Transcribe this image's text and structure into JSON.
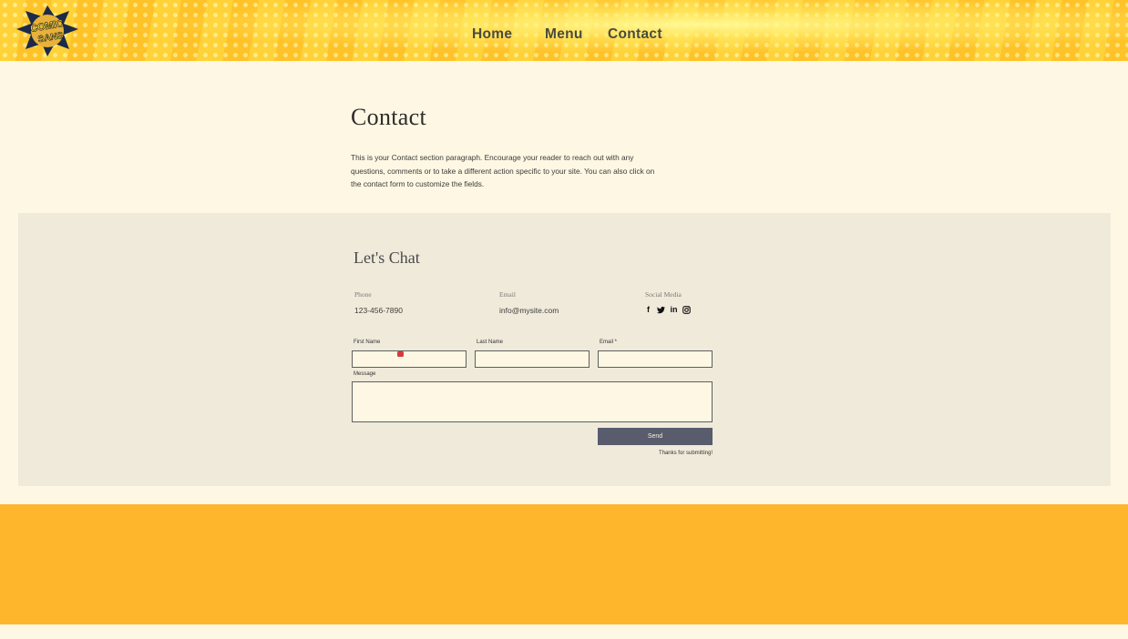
{
  "header": {
    "logo_text_top": "COMIC",
    "logo_text_bottom": "SANS",
    "nav": {
      "home": "Home",
      "menu": "Menu",
      "contact": "Contact"
    }
  },
  "contact": {
    "title": "Contact",
    "paragraph": "This is your Contact section paragraph. Encourage your reader to reach out with any questions, comments or to take a different action specific to your site. You can also click on the contact form to customize the fields."
  },
  "chat": {
    "title": "Let's Chat",
    "phone_label": "Phone",
    "phone_value": "123-456-7890",
    "email_label": "Email",
    "email_value": "info@mysite.com",
    "social_label": "Social Media",
    "social_icons": [
      "facebook-icon",
      "twitter-icon",
      "linkedin-icon",
      "instagram-icon"
    ]
  },
  "form": {
    "first_name_label": "First Name",
    "last_name_label": "Last Name",
    "email_label": "Email *",
    "message_label": "Message",
    "send_label": "Send",
    "thanks_text": "Thanks for submitting!"
  },
  "colors": {
    "background": "#fef7e3",
    "panel": "#f0eadb",
    "footer": "#feb62c",
    "send_button": "#585c6c"
  }
}
